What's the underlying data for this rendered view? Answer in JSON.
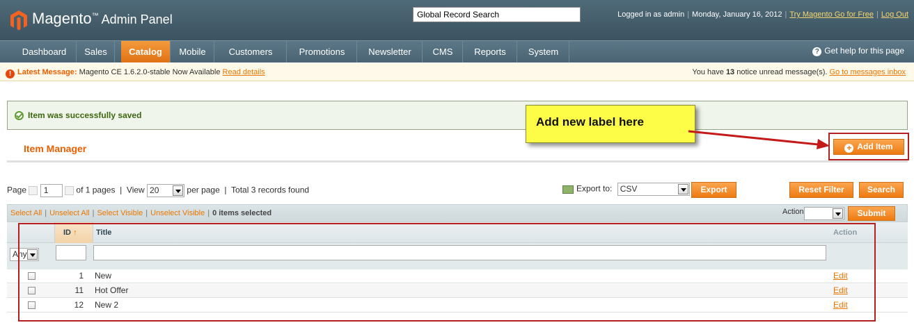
{
  "header": {
    "brand": "Magento",
    "brand_tm": "™",
    "brand_suffix": " Admin Panel",
    "search_placeholder": "Global Record Search",
    "logged_in": "Logged in as admin",
    "date": "Monday, January 16, 2012",
    "try_link": "Try Magento Go for Free",
    "logout_link": "Log Out"
  },
  "nav": {
    "items": [
      "Dashboard",
      "Sales",
      "Catalog",
      "Mobile",
      "Customers",
      "Promotions",
      "Newsletter",
      "CMS",
      "Reports",
      "System"
    ],
    "active": "Catalog",
    "help": "Get help for this page"
  },
  "message_bar": {
    "label": "Latest Message:",
    "text": "Magento CE 1.6.2.0-stable Now Available",
    "link": "Read details",
    "right_prefix": "You have",
    "count": "13",
    "right_suffix": "notice unread message(s).",
    "right_link": "Go to messages inbox"
  },
  "success": {
    "text": "Item was successfully saved"
  },
  "page": {
    "title": "Item Manager",
    "add_button": "Add Item"
  },
  "callout": {
    "text": "Add new label here"
  },
  "pager": {
    "page_label": "Page",
    "page_value": "1",
    "of_pages": "of 1 pages",
    "view_label": "View",
    "per_page_value": "20",
    "per_page_label": "per page",
    "total": "Total 3 records found"
  },
  "export": {
    "label": "Export to:",
    "format": "CSV",
    "button": "Export"
  },
  "filter_buttons": {
    "reset": "Reset Filter",
    "search": "Search"
  },
  "massaction": {
    "select_all": "Select All",
    "unselect_all": "Unselect All",
    "select_visible": "Select Visible",
    "unselect_visible": "Unselect Visible",
    "selected": "0 items selected",
    "actions_label": "Actions",
    "submit": "Submit"
  },
  "grid": {
    "columns": {
      "id": "ID",
      "title": "Title",
      "action": "Action"
    },
    "filter_any": "Any",
    "rows": [
      {
        "id": "1",
        "title": "New",
        "action": "Edit"
      },
      {
        "id": "11",
        "title": "Hot Offer",
        "action": "Edit"
      },
      {
        "id": "12",
        "title": "New 2",
        "action": "Edit"
      }
    ]
  }
}
